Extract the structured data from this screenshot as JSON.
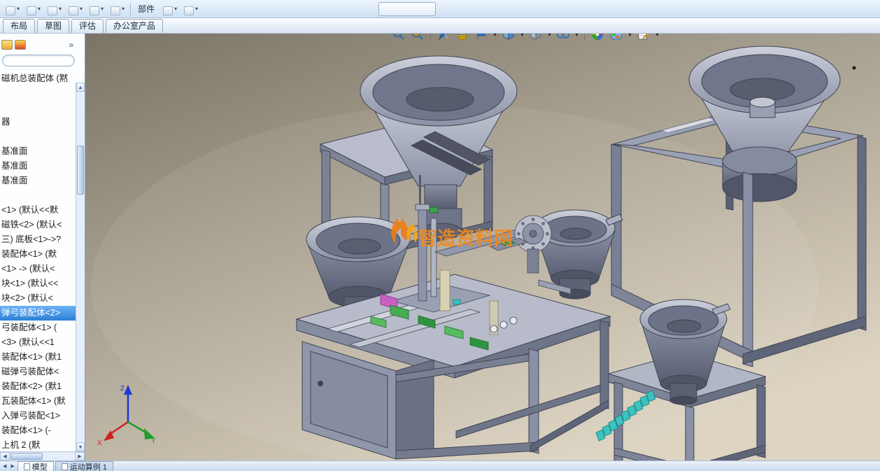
{
  "glyphs": {
    "dropdown": "▾",
    "up": "▲",
    "down": "▼",
    "left": "◀",
    "right": "▶"
  },
  "top_toolbar": {
    "component_label": "部件"
  },
  "command_tabs": {
    "items": [
      {
        "label": "布局"
      },
      {
        "label": "草图"
      },
      {
        "label": "评估"
      },
      {
        "label": "办公室产品"
      }
    ]
  },
  "panel": {
    "expand_chevron": "»",
    "tree_title": "磁机总装配体 (黙",
    "items": [
      {
        "label": ""
      },
      {
        "label": ""
      },
      {
        "label": "器"
      },
      {
        "label": ""
      },
      {
        "label": "基准面"
      },
      {
        "label": "基准面"
      },
      {
        "label": "基准面"
      },
      {
        "label": ""
      },
      {
        "label": "<1> (默认<<默"
      },
      {
        "label": "磁铁<2> (默认<"
      },
      {
        "label": "三) 底板<1>->?"
      },
      {
        "label": "装配体<1> (默"
      },
      {
        "label": "<1> -> (默认<"
      },
      {
        "label": "块<1> (默认<<"
      },
      {
        "label": "块<2> (默认<"
      },
      {
        "label": "弹弓装配体<2>",
        "selected": true
      },
      {
        "label": "弓装配体<1> ("
      },
      {
        "label": "<3> (默认<<1"
      },
      {
        "label": "装配体<1> (默1"
      },
      {
        "label": "磁弹弓装配体<"
      },
      {
        "label": "装配体<2> (默1"
      },
      {
        "label": "瓦装配体<1> (默"
      },
      {
        "label": "入弹弓装配<1>"
      },
      {
        "label": "装配体<1> (-"
      },
      {
        "label": "上机 2 (默"
      }
    ]
  },
  "view_toolbar": {
    "icons": [
      "zoom-fit-icon",
      "zoom-area-icon",
      "view-selector-icon",
      "section-view-icon",
      "annotations-icon",
      "view-orientation-icon",
      "display-style-icon",
      "hide-show-items-icon",
      "edit-appearance-icon",
      "apply-scene-icon",
      "view-settings-icon"
    ]
  },
  "triad": {
    "x_label": "X",
    "y_label": "Y",
    "z_label": "Z"
  },
  "watermark": {
    "text": "智造资料网"
  },
  "bottom_bar": {
    "tabs": [
      {
        "label": "模型",
        "active": true
      },
      {
        "label": "运动算例 1",
        "active": false
      }
    ]
  }
}
